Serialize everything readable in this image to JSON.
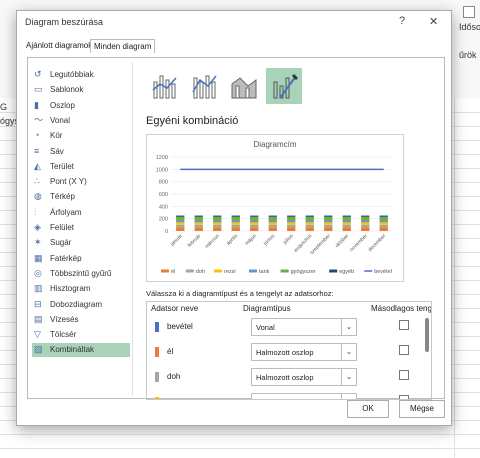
{
  "dialog": {
    "title": "Diagram beszúrása",
    "help": "?",
    "close": "✕",
    "tabs": [
      "Ajánlott diagramok",
      "Minden diagram"
    ],
    "active_tab": 1
  },
  "background": {
    "ribbon_right_text": "Idősor",
    "ribbon_right_text2": "űrök",
    "col_letter": "G",
    "cell_text": "ógys"
  },
  "chart_types": [
    {
      "label": "Legutóbbiak",
      "icon": "recent-icon"
    },
    {
      "label": "Sablonok",
      "icon": "templates-icon"
    },
    {
      "label": "Oszlop",
      "icon": "column-chart-icon"
    },
    {
      "label": "Vonal",
      "icon": "line-chart-icon"
    },
    {
      "label": "Kör",
      "icon": "pie-chart-icon"
    },
    {
      "label": "Sáv",
      "icon": "bar-chart-icon"
    },
    {
      "label": "Terület",
      "icon": "area-chart-icon"
    },
    {
      "label": "Pont (X Y)",
      "icon": "scatter-chart-icon"
    },
    {
      "label": "Térkép",
      "icon": "map-chart-icon"
    },
    {
      "label": "Árfolyam",
      "icon": "stock-chart-icon"
    },
    {
      "label": "Felület",
      "icon": "surface-chart-icon"
    },
    {
      "label": "Sugár",
      "icon": "radar-chart-icon"
    },
    {
      "label": "Fatérkép",
      "icon": "treemap-chart-icon"
    },
    {
      "label": "Többszintű gyűrű",
      "icon": "sunburst-chart-icon"
    },
    {
      "label": "Hisztogram",
      "icon": "histogram-chart-icon"
    },
    {
      "label": "Dobozdiagram",
      "icon": "boxplot-chart-icon"
    },
    {
      "label": "Vízesés",
      "icon": "waterfall-chart-icon"
    },
    {
      "label": "Tölcsér",
      "icon": "funnel-chart-icon"
    },
    {
      "label": "Kombináltak",
      "icon": "combo-chart-icon"
    }
  ],
  "selected_chart_type": 18,
  "combo_subtypes": [
    "Csoportosított oszlop – vonal",
    "Csoportosított oszlop – vonal a másodlagos tengelyen",
    "Halmozott terület – csoportosított oszlop",
    "Egyéni kombináció"
  ],
  "selected_subtype": 3,
  "section_title": "Egyéni kombináció",
  "assign_label": "Válassza ki a diagramtípust és a tengelyt az adatsorhoz:",
  "table_headers": {
    "name": "Adatsor neve",
    "type": "Diagramtípus",
    "secondary": "Másodlagos tengely"
  },
  "series_rows": [
    {
      "name": "bevétel",
      "type": "Vonal",
      "color": "#4472c4",
      "secondary": false
    },
    {
      "name": "él",
      "type": "Halmozott oszlop",
      "color": "#ed7d31",
      "secondary": false
    },
    {
      "name": "doh",
      "type": "Halmozott oszlop",
      "color": "#a5a5a5",
      "secondary": false
    },
    {
      "name": "",
      "type": "",
      "color": "#ffc000",
      "secondary": false
    }
  ],
  "buttons": {
    "ok": "OK",
    "cancel": "Mégse"
  },
  "colors": {
    "accent": "#a9d3b9",
    "line": "#4472c4"
  },
  "chart_data": {
    "type": "bar",
    "title": "Diagramcím",
    "categories": [
      "január",
      "február",
      "március",
      "április",
      "május",
      "június",
      "július",
      "augusztus",
      "szeptember",
      "október",
      "november",
      "december"
    ],
    "ylim": [
      0,
      1200
    ],
    "yticks": [
      0,
      200,
      400,
      600,
      800,
      1000,
      1200
    ],
    "stacked_series": [
      {
        "name": "él",
        "color": "#ed7d31",
        "values": [
          60,
          60,
          60,
          60,
          60,
          60,
          60,
          60,
          60,
          60,
          60,
          60
        ]
      },
      {
        "name": "doh",
        "color": "#a5a5a5",
        "values": [
          40,
          40,
          40,
          40,
          40,
          40,
          40,
          40,
          40,
          40,
          40,
          40
        ]
      },
      {
        "name": "rezsi",
        "color": "#ffc000",
        "values": [
          40,
          40,
          40,
          40,
          40,
          40,
          40,
          40,
          40,
          40,
          40,
          40
        ]
      },
      {
        "name": "tank",
        "color": "#5b9bd5",
        "values": [
          30,
          30,
          30,
          30,
          30,
          30,
          30,
          30,
          30,
          30,
          30,
          30
        ]
      },
      {
        "name": "gyógyszer",
        "color": "#70ad47",
        "values": [
          60,
          60,
          60,
          60,
          60,
          60,
          60,
          60,
          60,
          60,
          60,
          60
        ]
      },
      {
        "name": "egyéb",
        "color": "#264478",
        "values": [
          20,
          20,
          20,
          20,
          20,
          20,
          20,
          20,
          20,
          20,
          20,
          20
        ]
      }
    ],
    "line_series": {
      "name": "bevétel",
      "color": "#4472c4",
      "values": [
        1000,
        1000,
        1000,
        1000,
        1000,
        1000,
        1000,
        1000,
        1000,
        1000,
        1000,
        1000
      ]
    },
    "legend": [
      "él",
      "doh",
      "rezsi",
      "tank",
      "gyógyszer",
      "egyéb",
      "bevétel"
    ],
    "legend_position": "bottom"
  }
}
